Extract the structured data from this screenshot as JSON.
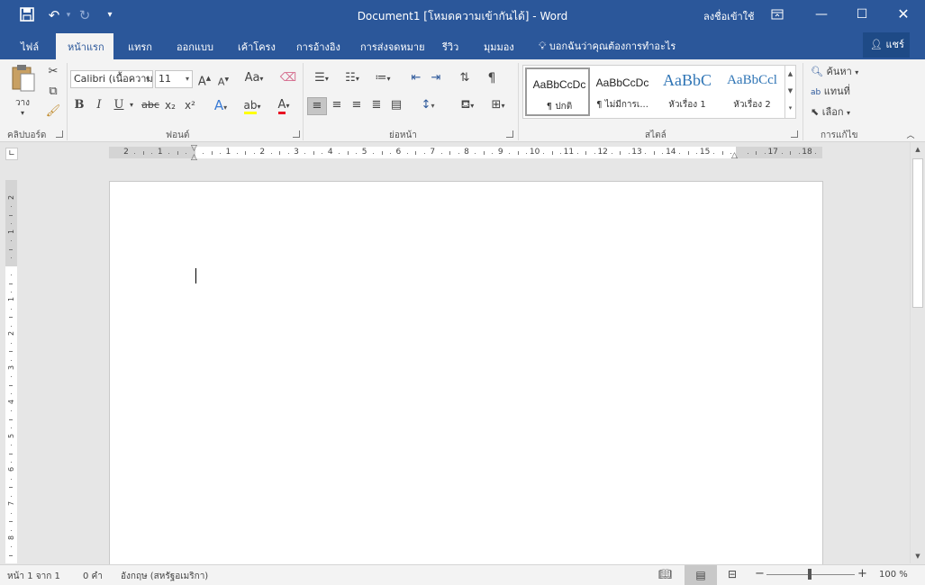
{
  "window": {
    "title": "Document1 [โหมดความเข้ากันได้] - Word",
    "signin": "ลงชื่อเข้าใช้",
    "qat": {
      "save": "save-icon",
      "undo": "undo-icon",
      "redo": "redo-icon",
      "more": "▾"
    }
  },
  "tabs": [
    "ไฟล์",
    "หน้าแรก",
    "แทรก",
    "ออกแบบ",
    "เค้าโครง",
    "การอ้างอิง",
    "การส่งจดหมาย",
    "รีวิว",
    "มุมมอง"
  ],
  "active_tab": "หน้าแรก",
  "tell_me": "บอกฉันว่าคุณต้องการทำอะไร",
  "share": "แชร์",
  "ribbon": {
    "clipboard": {
      "paste": "วาง",
      "label": "คลิปบอร์ด"
    },
    "font": {
      "name": "Calibri (เนื้อความ",
      "size": "11",
      "label": "ฟอนต์",
      "case": "Aa",
      "bold": "B",
      "italic": "I",
      "underline": "U",
      "strike": "abc",
      "sub": "x₂",
      "sup": "x²"
    },
    "paragraph": {
      "label": "ย่อหน้า",
      "pilcrow": "¶"
    },
    "styles": {
      "label": "สไตล์",
      "items": [
        {
          "preview": "AaBbCcDc",
          "name": "¶ ปกติ"
        },
        {
          "preview": "AaBbCcDc",
          "name": "¶ ไม่มีการเ..."
        },
        {
          "preview": "AaBbC",
          "name": "หัวเรื่อง 1"
        },
        {
          "preview": "AaBbCcl",
          "name": "หัวเรื่อง 2"
        }
      ]
    },
    "editing": {
      "label": "การแก้ไข",
      "find": "ค้นหา",
      "replace": "แทนที่",
      "select": "เลือก"
    }
  },
  "ruler": {
    "h_labels": [
      "2",
      "1",
      "",
      "1",
      "2",
      "3",
      "4",
      "5",
      "6",
      "7",
      "8",
      "9",
      "10",
      "11",
      "12",
      "13",
      "14",
      "15",
      "",
      "17",
      "18"
    ],
    "v_labels": [
      "2",
      "1",
      "",
      "1",
      "2",
      "3",
      "4",
      "5",
      "6",
      "7",
      "8"
    ]
  },
  "status": {
    "page": "หน้า 1 จาก 1",
    "words": "0 คำ",
    "language": "อังกฤษ (สหรัฐอเมริกา)",
    "zoom": "100 %"
  },
  "colors": {
    "accent": "#2b579a",
    "ribbon": "#f3f3f3",
    "highlight": "#ffff00",
    "font_color": "#e81123"
  }
}
